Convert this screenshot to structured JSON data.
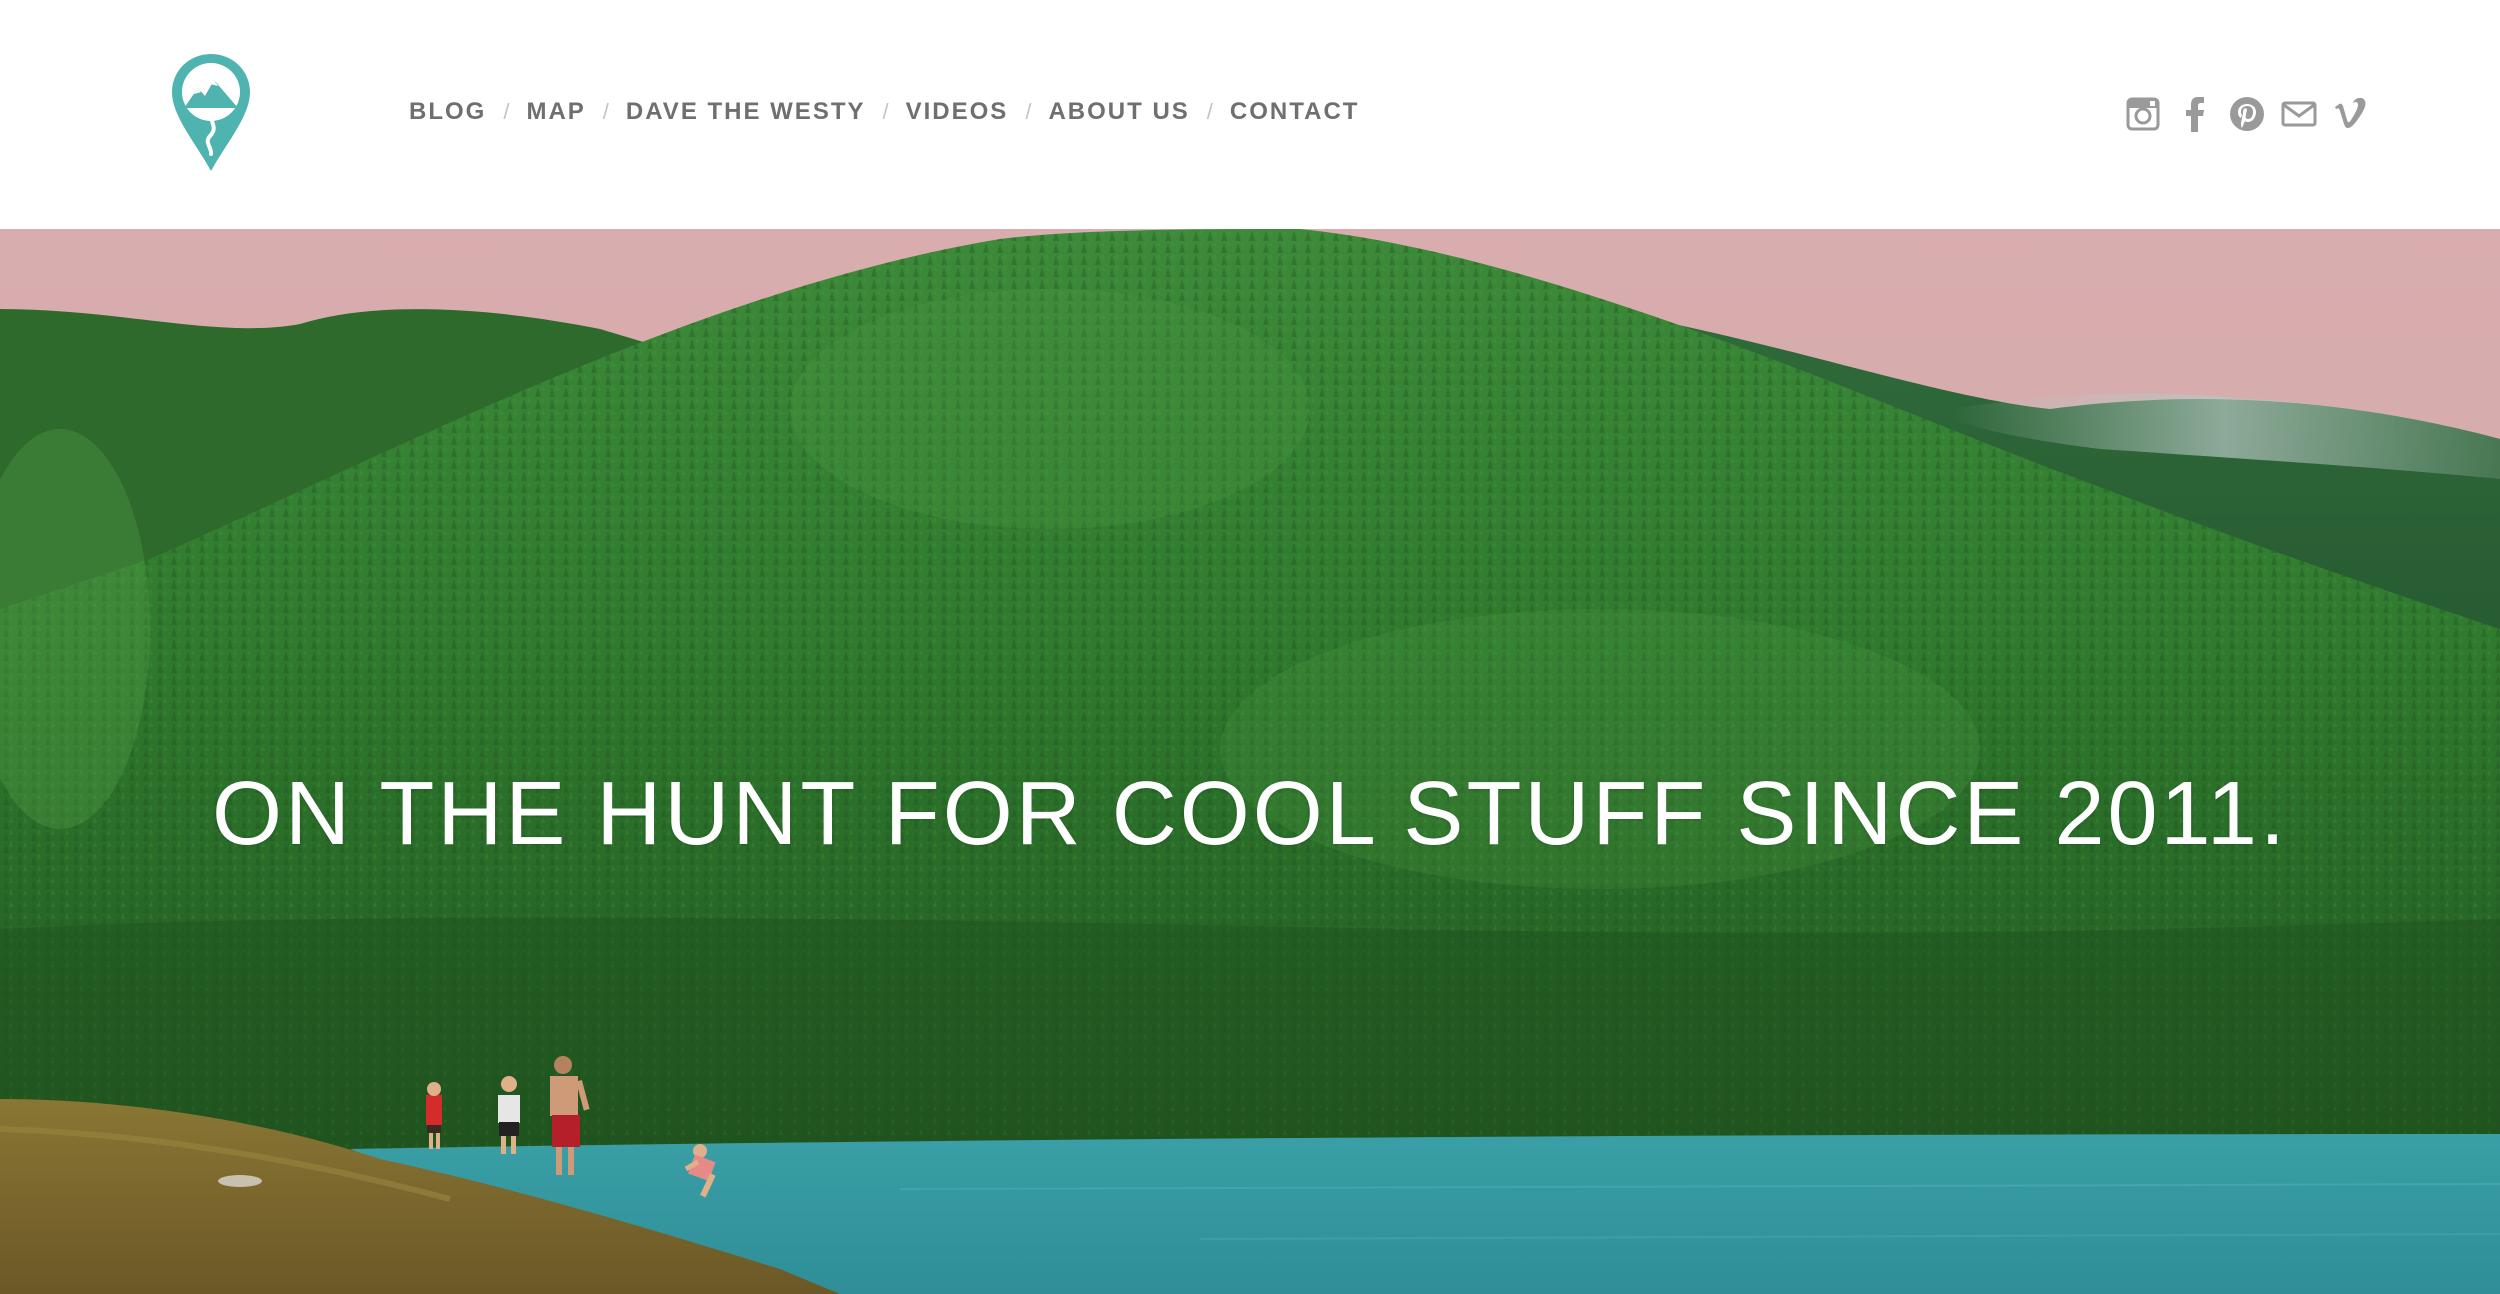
{
  "header": {
    "logo_icon": "map-pin-mountain-logo",
    "nav": [
      {
        "label": "BLOG"
      },
      {
        "label": "MAP"
      },
      {
        "label": "DAVE THE WESTY"
      },
      {
        "label": "VIDEOS"
      },
      {
        "label": "ABOUT US"
      },
      {
        "label": "CONTACT"
      }
    ],
    "nav_separator": "/",
    "social": [
      {
        "icon": "instagram-icon"
      },
      {
        "icon": "facebook-icon"
      },
      {
        "icon": "pinterest-icon"
      },
      {
        "icon": "mail-icon"
      },
      {
        "icon": "vimeo-icon"
      }
    ]
  },
  "hero": {
    "tagline": "ON THE HUNT FOR COOL STUFF SINCE 2011.",
    "image_subject": "forested-mountain-lake"
  },
  "colors": {
    "brand_teal": "#4fb3b0",
    "nav_text": "#6f6f6f",
    "nav_separator": "#c4c4c4",
    "social_icons": "#9a9a9a",
    "sky": "#d8aeb0",
    "forest": "#2f6f2c",
    "lake": "#3aa6ad",
    "rock": "#7f6a2e"
  }
}
